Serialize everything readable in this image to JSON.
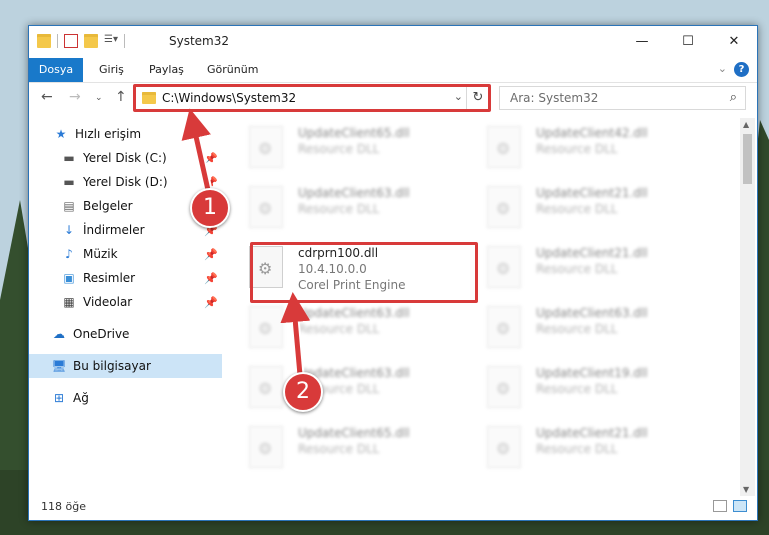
{
  "window": {
    "title": "System32",
    "controls": {
      "minimize": "—",
      "maximize": "☐",
      "close": "✕"
    }
  },
  "ribbon": {
    "tabs": [
      "Dosya",
      "Giriş",
      "Paylaş",
      "Görünüm"
    ],
    "help": "?"
  },
  "address": {
    "path": "C:\\Windows\\System32"
  },
  "search": {
    "placeholder": "Ara: System32"
  },
  "sidebar": {
    "items": [
      {
        "label": "Hızlı erişim",
        "icon": "star-icon"
      },
      {
        "label": "Yerel Disk (C:)",
        "icon": "drive-icon",
        "pinned": true
      },
      {
        "label": "Yerel Disk (D:)",
        "icon": "drive-icon",
        "pinned": true
      },
      {
        "label": "Belgeler",
        "icon": "document-icon",
        "pinned": true
      },
      {
        "label": "İndirmeler",
        "icon": "download-icon",
        "pinned": true
      },
      {
        "label": "Müzik",
        "icon": "music-icon",
        "pinned": true
      },
      {
        "label": "Resimler",
        "icon": "picture-icon",
        "pinned": true
      },
      {
        "label": "Videolar",
        "icon": "video-icon",
        "pinned": true
      },
      {
        "label": "OneDrive",
        "icon": "cloud-icon"
      },
      {
        "label": "Bu bilgisayar",
        "icon": "computer-icon",
        "selected": true
      },
      {
        "label": "Ağ",
        "icon": "network-icon"
      }
    ]
  },
  "files": [
    {
      "name": "UpdateClient65.dll",
      "line2": "Resource DLL",
      "line3": ""
    },
    {
      "name": "UpdateClient42.dll",
      "line2": "Resource DLL",
      "line3": ""
    },
    {
      "name": "UpdateClient63.dll",
      "line2": "Resource DLL",
      "line3": ""
    },
    {
      "name": "UpdateClient21.dll",
      "line2": "Resource DLL",
      "line3": ""
    },
    {
      "name": "cdrprn100.dll",
      "line2": "10.4.10.0.0",
      "line3": "Corel Print Engine",
      "highlight": true
    },
    {
      "name": "UpdateClient21.dll",
      "line2": "Resource DLL",
      "line3": ""
    },
    {
      "name": "UpdateClient63.dll",
      "line2": "Resource DLL",
      "line3": ""
    },
    {
      "name": "UpdateClient63.dll",
      "line2": "Resource DLL",
      "line3": ""
    },
    {
      "name": "UpdateClient63.dll",
      "line2": "Resource DLL",
      "line3": ""
    },
    {
      "name": "UpdateClient19.dll",
      "line2": "Resource DLL",
      "line3": ""
    },
    {
      "name": "UpdateClient65.dll",
      "line2": "Resource DLL",
      "line3": ""
    },
    {
      "name": "UpdateClient21.dll",
      "line2": "Resource DLL",
      "line3": ""
    }
  ],
  "status": {
    "count": "118 öğe"
  },
  "callouts": {
    "first": "1",
    "second": "2"
  },
  "colors": {
    "accent": "#1979ca",
    "highlight": "#d83a3a",
    "selection": "#cce4f7"
  }
}
